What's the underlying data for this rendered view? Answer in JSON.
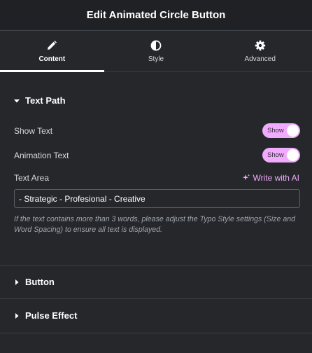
{
  "header": {
    "title": "Edit Animated Circle Button"
  },
  "tabs": [
    {
      "label": "Content",
      "icon": "pencil-icon",
      "active": true
    },
    {
      "label": "Style",
      "icon": "half-circle-icon",
      "active": false
    },
    {
      "label": "Advanced",
      "icon": "gear-icon",
      "active": false
    }
  ],
  "text_path": {
    "title": "Text Path",
    "show_text": {
      "label": "Show Text",
      "toggle_label": "Show"
    },
    "animation_text": {
      "label": "Animation Text",
      "toggle_label": "Show"
    },
    "text_area": {
      "label": "Text Area",
      "ai_label": "Write with AI",
      "value": "- Strategic - Profesional - Creative"
    },
    "help": "If the text contains more than 3 words, please adjust the Typo Style settings (Size and Word Spacing) to ensure all text is displayed."
  },
  "sections": [
    {
      "title": "Button"
    },
    {
      "title": "Pulse Effect"
    }
  ],
  "colors": {
    "accent": "#f0abfc",
    "panel": "#26272b",
    "header": "#202124"
  }
}
